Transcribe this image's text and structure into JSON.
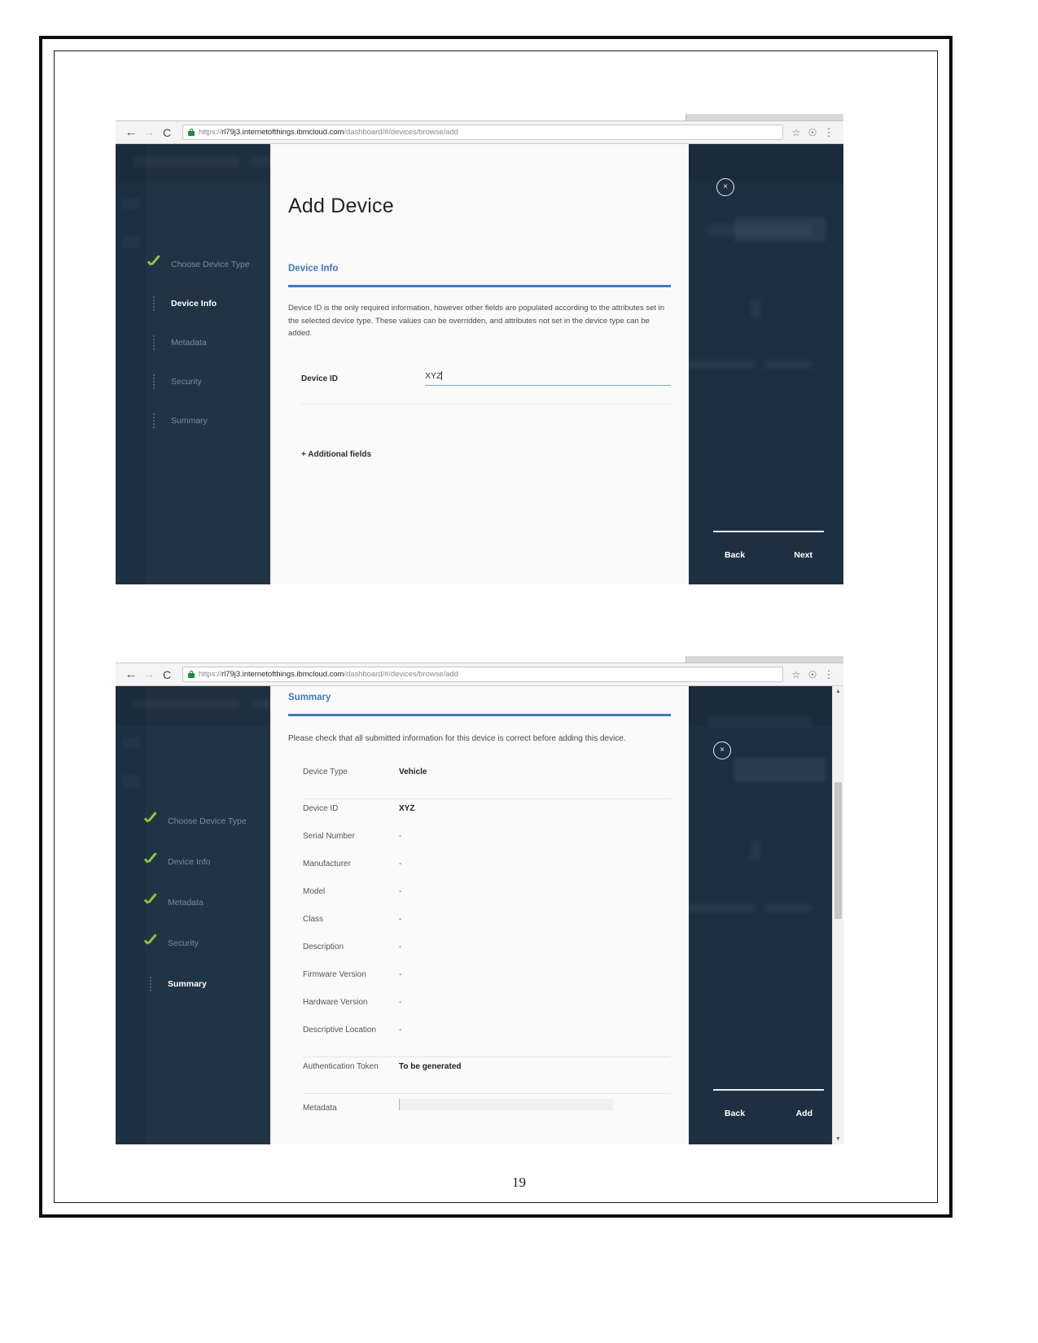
{
  "document": {
    "page_number": "19"
  },
  "browser": {
    "back_icon": "back-arrow-icon",
    "forward_icon": "forward-arrow-icon",
    "reload_label": "C",
    "bookmark_icon": "star-icon",
    "profile_icon": "profile-icon",
    "menu_icon": "kebab-menu-icon",
    "url_scheme": "https://",
    "url_host": "rl79j3.internetofthings.ibmcloud.com",
    "url_path": "/dashboard/#/devices/browse/add"
  },
  "screenshot_top": {
    "modal_title": "Add Device",
    "section_heading": "Device Info",
    "intro_text": "Device ID is the only required information, however other fields are populated according to the attributes set in the selected device type. These values can be overridden, and attributes not set in the device type can be added.",
    "field_label": "Device ID",
    "field_value": "XYZ",
    "field_placeholder": "Device ID",
    "additional_fields_label": "+ Additional fields",
    "close_label": "×",
    "back_label": "Back",
    "next_label": "Next",
    "steps": [
      {
        "label": "Choose Device Type",
        "state": "done"
      },
      {
        "label": "Device Info",
        "state": "current"
      },
      {
        "label": "Metadata",
        "state": "pending"
      },
      {
        "label": "Security",
        "state": "pending"
      },
      {
        "label": "Summary",
        "state": "pending"
      }
    ]
  },
  "screenshot_bottom": {
    "section_heading": "Summary",
    "note_text": "Please check that all submitted information for this device is correct before adding this device.",
    "close_label": "×",
    "back_label": "Back",
    "add_label": "Add",
    "scroll_up_icon": "chevron-up-icon",
    "scroll_down_icon": "chevron-down-icon",
    "steps": [
      {
        "label": "Choose Device Type",
        "state": "done"
      },
      {
        "label": "Device Info",
        "state": "done"
      },
      {
        "label": "Metadata",
        "state": "done"
      },
      {
        "label": "Security",
        "state": "done"
      },
      {
        "label": "Summary",
        "state": "current"
      }
    ],
    "summary_rows": [
      {
        "key": "Device Type",
        "value": "Vehicle"
      },
      {
        "key": "Device ID",
        "value": "XYZ"
      },
      {
        "key": "Serial Number",
        "value": "-"
      },
      {
        "key": "Manufacturer",
        "value": "-"
      },
      {
        "key": "Model",
        "value": "-"
      },
      {
        "key": "Class",
        "value": "-"
      },
      {
        "key": "Description",
        "value": "-"
      },
      {
        "key": "Firmware Version",
        "value": "-"
      },
      {
        "key": "Hardware Version",
        "value": "-"
      },
      {
        "key": "Descriptive Location",
        "value": "-"
      },
      {
        "key": "Authentication Token",
        "value": "To be generated"
      },
      {
        "key": "Metadata",
        "value": ""
      }
    ]
  },
  "colors": {
    "app_background": "#1d3043",
    "accent_blue": "#3d7bbf",
    "check_green": "#8dc63f",
    "modal_background": "#fafafa"
  }
}
